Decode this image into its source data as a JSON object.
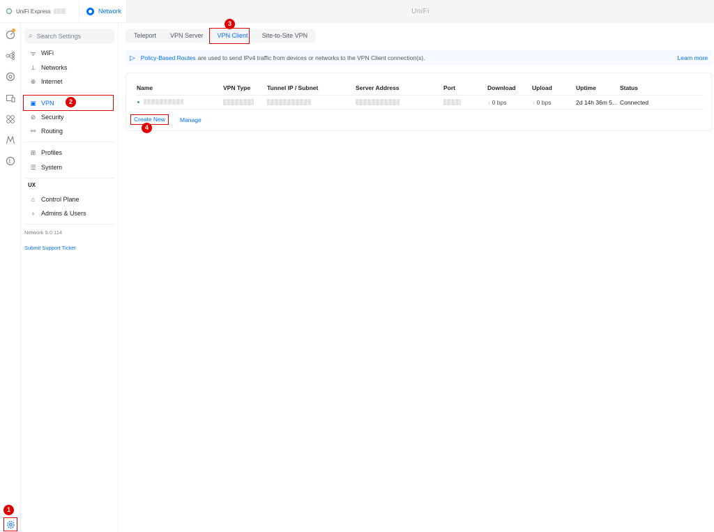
{
  "header": {
    "device_name": "UniFi Express",
    "app_label": "Network",
    "title": "UniFi"
  },
  "rail": {
    "icons": [
      "dashboard-icon",
      "topology-icon",
      "devices-icon",
      "clients-icon",
      "apps-icon",
      "insights-icon",
      "alerts-icon",
      "settings-icon"
    ]
  },
  "sidebar": {
    "search_placeholder": "Search Settings",
    "items": [
      {
        "label": "WiFi",
        "icon": "wifi-icon"
      },
      {
        "label": "Networks",
        "icon": "networks-icon"
      },
      {
        "label": "Internet",
        "icon": "globe-icon"
      },
      {
        "label": "VPN",
        "icon": "vpn-icon",
        "active": true
      },
      {
        "label": "Security",
        "icon": "shield-icon"
      },
      {
        "label": "Routing",
        "icon": "routing-icon"
      },
      {
        "label": "Profiles",
        "icon": "profiles-icon"
      },
      {
        "label": "System",
        "icon": "system-icon"
      }
    ],
    "ux_heading": "UX",
    "ux_items": [
      {
        "label": "Control Plane",
        "icon": "control-plane-icon"
      },
      {
        "label": "Admins & Users",
        "icon": "users-icon"
      }
    ],
    "version": "Network 9.0.114",
    "support_link": "Submit Support Ticket"
  },
  "tabs": [
    "Teleport",
    "VPN Server",
    "VPN Client",
    "Site-to-Site VPN"
  ],
  "active_tab": "VPN Client",
  "banner": {
    "link": "Policy-Based Routes",
    "text": "are used to send IPv4 traffic from devices or networks to the VPN Client connection(s).",
    "learn_more": "Learn more"
  },
  "table": {
    "headers": [
      "Name",
      "VPN Type",
      "Tunnel IP / Subnet",
      "Server Address",
      "Port",
      "Download",
      "Upload",
      "Uptime",
      "Status"
    ],
    "row": {
      "download": "0 bps",
      "upload": "0 bps",
      "uptime": "2d 14h 36m 5...",
      "status": "Connected"
    }
  },
  "actions": {
    "create_new": "Create New",
    "manage": "Manage"
  },
  "markers": [
    "1",
    "2",
    "3",
    "4"
  ],
  "colors": {
    "accent": "#006fff",
    "highlight": "#e00000",
    "status_ok": "#38a85a"
  }
}
